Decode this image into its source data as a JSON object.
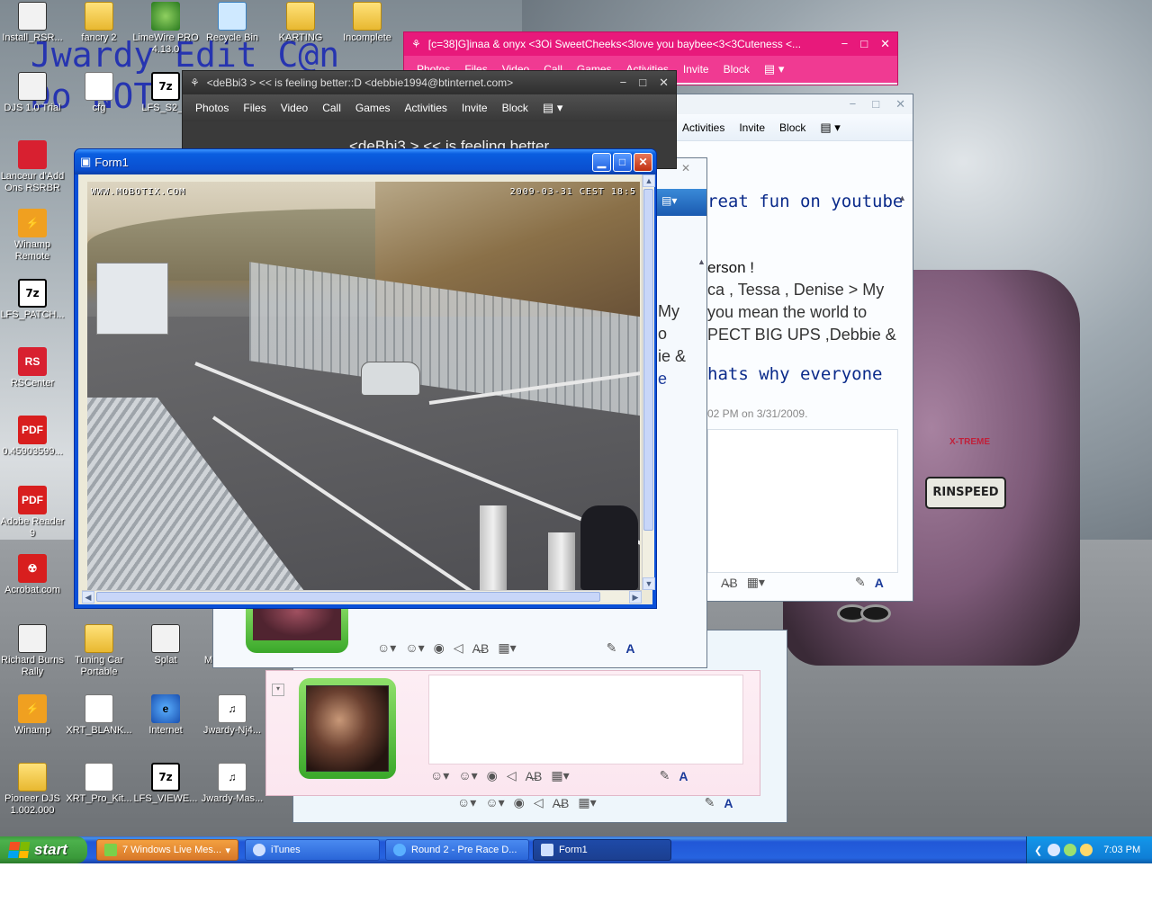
{
  "desktop_icons": [
    {
      "label": "Install_RSR...",
      "icon": "app-icon"
    },
    {
      "label": "fancry 2",
      "icon": "folder-icon"
    },
    {
      "label": "LimeWire PRO 4.13.0",
      "icon": "limewire-icon"
    },
    {
      "label": "Recycle Bin",
      "icon": "recycle-bin-icon"
    },
    {
      "label": "KARTING",
      "icon": "folder-icon"
    },
    {
      "label": "Incomplete",
      "icon": "folder-icon"
    },
    {
      "label": "DJS 1.0 Trial",
      "icon": "app-icon"
    },
    {
      "label": "cfg",
      "icon": "document-icon"
    },
    {
      "label": "LFS_S2_A",
      "icon": "7zip-icon"
    },
    {
      "label": "Lanceur d'Add Ons RSRBR",
      "icon": "rocket-icon"
    },
    {
      "label": "Winamp Remote",
      "icon": "winamp-icon"
    },
    {
      "label": "LFS_PATCH...",
      "icon": "7zip-icon"
    },
    {
      "label": "RSCenter",
      "icon": "rscenter-icon"
    },
    {
      "label": "0.45903599...",
      "icon": "pdf-icon"
    },
    {
      "label": "Adobe Reader 9",
      "icon": "pdf-icon"
    },
    {
      "label": "Acrobat.com",
      "icon": "acrobat-icon"
    },
    {
      "label": "Richard Burns Rally",
      "icon": "app-icon"
    },
    {
      "label": "Tuning Car Portable",
      "icon": "folder-icon"
    },
    {
      "label": "Splat",
      "icon": "app-icon"
    },
    {
      "label": "Mcintyre Li...",
      "icon": "app-icon"
    },
    {
      "label": "Winamp",
      "icon": "winamp-icon"
    },
    {
      "label": "XRT_BLANK...",
      "icon": "document-icon"
    },
    {
      "label": "Internet",
      "icon": "internet-icon"
    },
    {
      "label": "Jwardy-Nj4...",
      "icon": "mp3-icon"
    },
    {
      "label": "Pioneer DJS 1.002.000",
      "icon": "folder-icon"
    },
    {
      "label": "XRT_Pro_Kit...",
      "icon": "document-icon"
    },
    {
      "label": "LFS_VIEWE...",
      "icon": "7zip-icon"
    },
    {
      "label": "Jwardy-Mas...",
      "icon": "mp3-icon"
    }
  ],
  "wallpaper": {
    "overlay_text": "Jwardy Edit C@n\nDo NOT",
    "plate": "RINSPEED",
    "car_logo": "X-TREME"
  },
  "msn_windows": {
    "pink": {
      "title": "[c=38]G]inaa & onyx <3Oi SweetCheeks<3love you baybee<3<3Cuteness <...",
      "menu": [
        "Photos",
        "Files",
        "Video",
        "Call",
        "Games",
        "Activities",
        "Invite",
        "Block"
      ],
      "accent": "#e8197b"
    },
    "debbie": {
      "title": "<deBbi3 > << is feeling better::D <debbie1994@btinternet.com>",
      "menu": [
        "Photos",
        "Files",
        "Video",
        "Call",
        "Games",
        "Activities",
        "Invite",
        "Block"
      ],
      "banner": "<deBbi3 > << is feeling better"
    },
    "right": {
      "menu": [
        "Activities",
        "Invite",
        "Block"
      ],
      "lines": [
        "reat fun on youtube",
        "erson !",
        "ca , Tessa , Denise > My",
        "you mean the world to",
        "PECT BIG UPS ,Debbie &",
        "hats why everyone"
      ],
      "timestamp": "02 PM on 3/31/2009.",
      "snippets": [
        "My",
        "o",
        "ie &",
        "e"
      ]
    }
  },
  "form1": {
    "title": "Form1",
    "cam_stamp_left": "WWW.MOBOTIX.COM",
    "cam_stamp_right": "2009-03-31 CEST 18:5"
  },
  "taskbar": {
    "start_label": "start",
    "tasks": [
      {
        "label": "7 Windows Live Mes...",
        "type": "group"
      },
      {
        "label": "iTunes",
        "type": "norm"
      },
      {
        "label": "Round 2 - Pre Race D...",
        "type": "norm"
      },
      {
        "label": "Form1",
        "type": "active"
      }
    ],
    "clock": "7:03 PM"
  }
}
